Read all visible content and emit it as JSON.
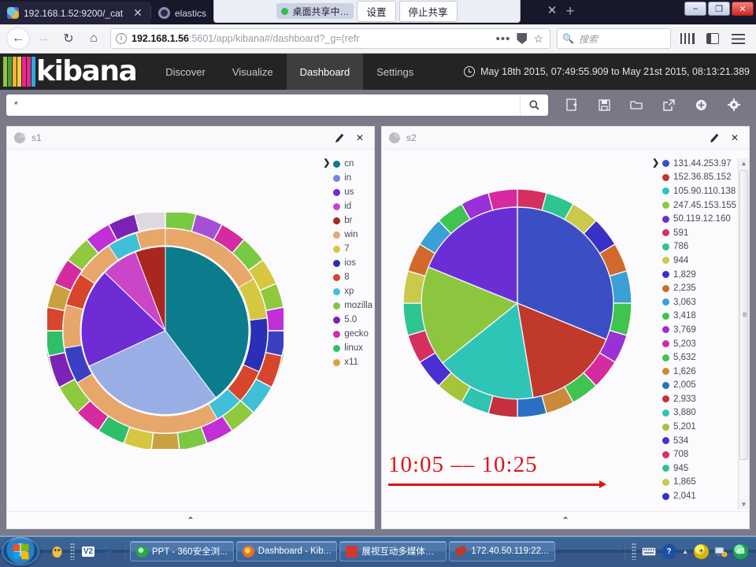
{
  "browser": {
    "tabs": [
      {
        "title": "192.168.1.52:9200/_cat",
        "favicon": "elasticsearch-icon",
        "active": true,
        "close_label": "✕"
      },
      {
        "title": "elastics",
        "favicon": "elasticsearch-icon",
        "active": false,
        "close_label": ""
      }
    ],
    "share_bar": {
      "status_label": "桌面共享中…",
      "settings_label": "设置",
      "stop_label": "停止共享",
      "close_label": "✕"
    },
    "new_tab_label": "+",
    "window_controls": {
      "minimize": "–",
      "maximize": "❐",
      "close": "✕"
    },
    "nav": {
      "back": "←",
      "forward": "→",
      "reload": "↻",
      "home": "⌂"
    },
    "url": {
      "host": "192.168.1.56",
      "rest": ":5601/app/kibana#/dashboard?_g=(refr",
      "info_icon": "info-icon"
    },
    "url_actions": {
      "more": "•••",
      "shield": "shield-icon",
      "bookmark": "☆"
    },
    "search": {
      "placeholder": "搜索",
      "icon": "search-icon"
    },
    "toolbar_right": {
      "library": "library-icon",
      "sidebar": "sidebar-icon",
      "menu": "hamburger-icon"
    }
  },
  "kibana": {
    "brand": "kibana",
    "logo_colors": [
      "#8dc63f",
      "#4c9e3c",
      "#f2b134",
      "#f4d03f",
      "#ec268f",
      "#ec268f",
      "#2ba9e0"
    ],
    "nav": [
      {
        "label": "Discover",
        "active": false
      },
      {
        "label": "Visualize",
        "active": false
      },
      {
        "label": "Dashboard",
        "active": true
      },
      {
        "label": "Settings",
        "active": false
      }
    ],
    "time_range": "May 18th 2015, 07:49:55.909 to May 21st 2015, 08:13:21.389",
    "time_icon": "clock-icon",
    "query": {
      "value": "*",
      "search_icon": "search-icon"
    },
    "tools": [
      {
        "name": "new-dashboard-icon",
        "label": "New Dashboard"
      },
      {
        "name": "save-icon",
        "label": "Save"
      },
      {
        "name": "load-icon",
        "label": "Load"
      },
      {
        "name": "share-icon",
        "label": "Share"
      },
      {
        "name": "add-visualization-icon",
        "label": "Add Visualization"
      },
      {
        "name": "options-icon",
        "label": "Options"
      }
    ]
  },
  "panels": [
    {
      "title": "s1",
      "icon": "pie-chart-icon",
      "edit_label": "✎",
      "close_label": "✕",
      "expand_label": "⌃",
      "legend_toggle": "❯",
      "legend": [
        {
          "label": "cn",
          "color": "#0b7c8c"
        },
        {
          "label": "in",
          "color": "#7d82e0"
        },
        {
          "label": "us",
          "color": "#6f2bd4"
        },
        {
          "label": "id",
          "color": "#cb45c8"
        },
        {
          "label": "br",
          "color": "#a8281f"
        },
        {
          "label": "win",
          "color": "#e8a76a"
        },
        {
          "label": "7",
          "color": "#d6c741"
        },
        {
          "label": "ios",
          "color": "#2a2fb5"
        },
        {
          "label": "8",
          "color": "#d6452c"
        },
        {
          "label": "xp",
          "color": "#3fc0d6"
        },
        {
          "label": "mozilla",
          "color": "#7ac943"
        },
        {
          "label": "5.0",
          "color": "#7c22b5"
        },
        {
          "label": "gecko",
          "color": "#d62ba0"
        },
        {
          "label": "linux",
          "color": "#2fbf68"
        },
        {
          "label": "x11",
          "color": "#e0a040"
        }
      ]
    },
    {
      "title": "s2",
      "icon": "pie-chart-icon",
      "edit_label": "✎",
      "close_label": "✕",
      "expand_label": "⌃",
      "legend_toggle": "❯",
      "annotation": {
        "text": "10:05  ––  10:25",
        "color": "#e01414"
      },
      "legend": [
        {
          "label": "131.44.253.97",
          "color": "#3b4fc4"
        },
        {
          "label": "152.36.85.152",
          "color": "#c0392b"
        },
        {
          "label": "105.90.110.138",
          "color": "#2ec4b6"
        },
        {
          "label": "247.45.153.155",
          "color": "#8cc63f"
        },
        {
          "label": "50.119.12.160",
          "color": "#6a2fd4"
        },
        {
          "label": "591",
          "color": "#d63060"
        },
        {
          "label": "786",
          "color": "#2ec48f"
        },
        {
          "label": "944",
          "color": "#c9c94a"
        },
        {
          "label": "1,829",
          "color": "#3a30c4"
        },
        {
          "label": "2,235",
          "color": "#d06a2c"
        },
        {
          "label": "3,063",
          "color": "#3aa0d6"
        },
        {
          "label": "3,418",
          "color": "#3fc44f"
        },
        {
          "label": "3,769",
          "color": "#9b30d6"
        },
        {
          "label": "5,203",
          "color": "#d62ba0"
        },
        {
          "label": "5,632",
          "color": "#3fc450"
        },
        {
          "label": "1,626",
          "color": "#c98a3a"
        },
        {
          "label": "2,005",
          "color": "#2a6fc4"
        },
        {
          "label": "2,933",
          "color": "#c43040"
        },
        {
          "label": "3,880",
          "color": "#2ec4b0"
        },
        {
          "label": "5,201",
          "color": "#a6c43a"
        },
        {
          "label": "534",
          "color": "#4a2fd4"
        },
        {
          "label": "708",
          "color": "#d63060"
        },
        {
          "label": "945",
          "color": "#2ec48f"
        },
        {
          "label": "1,865",
          "color": "#c9c94a"
        },
        {
          "label": "2,041",
          "color": "#3030c4"
        }
      ]
    }
  ],
  "chart_data": [
    {
      "type": "pie",
      "title": "s1",
      "legend_position": "right",
      "rings": [
        {
          "level": 1,
          "labels": [
            "cn",
            "in",
            "us",
            "id",
            "br"
          ],
          "values": [
            38,
            30,
            18,
            9,
            5
          ],
          "colors": [
            "#0b7c8c",
            "#9aaee6",
            "#6f2bd4",
            "#cb45c8",
            "#a8281f"
          ]
        },
        {
          "level": 2,
          "labels": [
            "win",
            "7",
            "ios",
            "8",
            "xp"
          ],
          "values": [
            42,
            18,
            14,
            14,
            12
          ],
          "colors": [
            "#e8a76a",
            "#d6c741",
            "#2a2fb5",
            "#d6452c",
            "#3fc0d6"
          ]
        },
        {
          "level": 3,
          "labels": [
            "mozilla",
            "5.0",
            "gecko",
            "linux",
            "x11"
          ],
          "values": [
            30,
            22,
            20,
            16,
            12
          ],
          "colors": [
            "#7ac943",
            "#7c22b5",
            "#d62ba0",
            "#2fbf68",
            "#e0a040"
          ]
        }
      ]
    },
    {
      "type": "pie",
      "title": "s2",
      "legend_position": "right",
      "rings": [
        {
          "level": 1,
          "labels": [
            "131.44.253.97",
            "152.36.85.152",
            "105.90.110.138",
            "247.45.153.155",
            "50.119.12.160"
          ],
          "values": [
            25,
            21,
            18,
            19,
            17
          ],
          "colors": [
            "#3b4fc4",
            "#c0392b",
            "#2ec4b6",
            "#8cc63f",
            "#6a2fd4"
          ]
        },
        {
          "level": 2,
          "labels": [
            "591",
            "786",
            "944",
            "1,829",
            "2,235",
            "3,063",
            "3,418",
            "3,769",
            "5,203",
            "5,632",
            "1,626",
            "2,005",
            "2,933",
            "3,880",
            "5,201",
            "534",
            "708",
            "945",
            "1,865",
            "2,041"
          ],
          "values": [
            5,
            5,
            5,
            5,
            5,
            5,
            5,
            5,
            5,
            5,
            5,
            5,
            5,
            5,
            5,
            5,
            5,
            5,
            5,
            5
          ],
          "colors": [
            "#d63060",
            "#2ec48f",
            "#c9c94a",
            "#3a30c4",
            "#d06a2c",
            "#3aa0d6",
            "#3fc44f",
            "#9b30d6",
            "#d62ba0",
            "#3fc450",
            "#c98a3a",
            "#2a6fc4",
            "#c43040",
            "#2ec4b0",
            "#a6c43a",
            "#4a2fd4",
            "#d63060",
            "#2ec48f",
            "#c9c94a",
            "#3030c4"
          ]
        }
      ]
    }
  ],
  "taskbar": {
    "start_label": "start",
    "quick_launch": [
      {
        "name": "qq-icon",
        "label": ""
      },
      {
        "name": "grip-handle",
        "label": ""
      },
      {
        "name": "v2-icon",
        "label": "V2"
      },
      {
        "name": "powerpoint-icon",
        "label": "P"
      }
    ],
    "tasks": [
      {
        "label": "PPT - 360安全浏...",
        "icon": "ie-icon",
        "color": "#2aa84a"
      },
      {
        "label": "Dashboard - Kib...",
        "icon": "firefox-icon",
        "color": "#e8712b"
      },
      {
        "label": "展视互动多媒体直...",
        "icon": "media-icon",
        "color": "#d03a2c"
      },
      {
        "label": "172.40.50.119:22...",
        "icon": "xshell-icon",
        "color": "#c0392b"
      }
    ],
    "tray": [
      {
        "name": "keyboard-icon",
        "label": ""
      },
      {
        "name": "help-icon",
        "label": "?"
      },
      {
        "name": "show-hidden-icon",
        "label": "▲"
      },
      {
        "name": "update-icon",
        "label": "+"
      },
      {
        "name": "network-icon",
        "label": ""
      },
      {
        "name": "counter-badge",
        "label": "43"
      }
    ]
  }
}
